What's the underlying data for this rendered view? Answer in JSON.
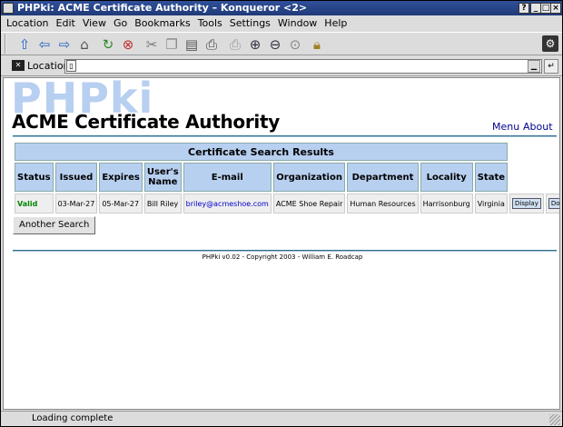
{
  "window": {
    "title": "PHPki: ACME Certificate Authority  – Konqueror <2>",
    "buttons": [
      "?",
      "_",
      "□",
      "×"
    ]
  },
  "menubar": [
    "Location",
    "Edit",
    "View",
    "Go",
    "Bookmarks",
    "Tools",
    "Settings",
    "Window",
    "Help"
  ],
  "toolbar": {
    "icons": [
      "up-icon",
      "back-icon",
      "forward-icon",
      "home-icon",
      "reload-icon",
      "stop-icon",
      "cut-icon",
      "copy-icon",
      "paste-icon",
      "print-icon",
      "print-frame-icon",
      "zoom-in-icon",
      "zoom-out-icon",
      "zoom-fit-icon",
      "security-lock-icon",
      "konqueror-gear-icon"
    ]
  },
  "locationbar": {
    "label": "Location",
    "value": ""
  },
  "page": {
    "logo_text": "PHPki",
    "org_name": "ACME Certificate Authority",
    "nav": [
      "Menu",
      "About"
    ],
    "table": {
      "caption": "Certificate Search Results",
      "headers": [
        "Status",
        "Issued",
        "Expires",
        "User's Name",
        "E-mail",
        "Organization",
        "Department",
        "Locality",
        "State"
      ],
      "rows": [
        {
          "status": "Valid",
          "issued": "03-Mar-27",
          "expires": "05-Mar-27",
          "name": "Bill Riley",
          "email": "briley@acmeshoe.com",
          "organization": "ACME Shoe Repair",
          "department": "Human Resources",
          "locality": "Harrisonburg",
          "state": "Virginia",
          "actions": [
            "Display",
            "Download"
          ]
        }
      ]
    },
    "another_search": "Another Search",
    "footer": "PHPki v0.02 - Copyright 2003 - William E. Roadcap"
  },
  "statusbar": {
    "text": "Loading complete"
  },
  "colors": {
    "titlebar": "#203a78",
    "table_header": "#b8d0f0",
    "status_valid": "#008800",
    "link": "#00008b",
    "logo": "#b7cff0"
  }
}
